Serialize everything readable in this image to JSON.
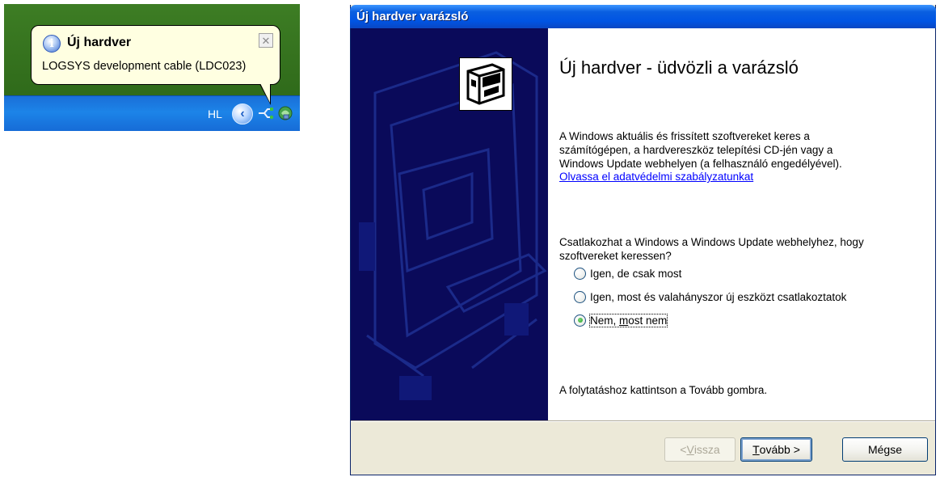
{
  "balloon": {
    "title": "Új hardver",
    "message": "LOGSYS development cable (LDC023)",
    "close_glyph": "✕",
    "icon": "info-icon"
  },
  "taskbar": {
    "language": "HL",
    "expand_glyph": "‹",
    "tray_icons": [
      "usb-safely-remove-icon",
      "network-icon"
    ]
  },
  "wizard": {
    "window_title": "Új hardver varázsló",
    "heading": "Új hardver - üdvözli a varázsló",
    "intro_lines": [
      "A Windows aktuális és frissített szoftvereket keres a",
      "számítógépen, a hardvereszköz telepítési CD-jén vagy a",
      "Windows Update webhelyen (a felhasználó engedélyével)."
    ],
    "privacy_link": "Olvassa el adatvédelmi szabályzatunkat",
    "question_lines": [
      "Csatlakozhat a Windows a Windows Update webhelyhez, hogy",
      "szoftvereket keressen?"
    ],
    "options": [
      {
        "pre": "I",
        "key": "g",
        "post": "en, de csak most",
        "checked": false
      },
      {
        "pre": "I",
        "key": "g",
        "post": "en, most és valahányszor új eszközt csatlakoztatok",
        "checked": false
      },
      {
        "pre": "Nem, ",
        "key": "m",
        "post": "ost nem",
        "checked": true
      }
    ],
    "continue_hint": "A folytatáshoz kattintson a Tovább gombra.",
    "buttons": {
      "back": {
        "pre": "< ",
        "key": "V",
        "post": "issza",
        "enabled": false
      },
      "next": {
        "pre": "",
        "key": "T",
        "post": "ovább >",
        "enabled": true
      },
      "cancel": {
        "label": "Mégse",
        "enabled": true
      }
    },
    "icon": "hardware-device-icon"
  }
}
